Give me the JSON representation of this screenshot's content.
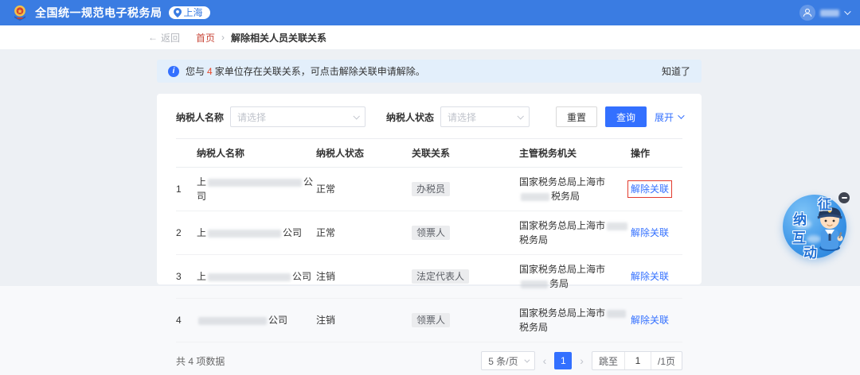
{
  "header": {
    "title": "全国统一规范电子税务局",
    "location": "上海"
  },
  "breadcrumb": {
    "back": "返回",
    "home": "首页",
    "sep": "›",
    "current": "解除相关人员关联关系"
  },
  "banner": {
    "before": "您与",
    "count": "4",
    "after": "家单位存在关联关系，可点击解除关联申请解除。",
    "dismiss": "知道了"
  },
  "filters": {
    "name_label": "纳税人名称",
    "name_value": "请选择",
    "status_label": "纳税人状态",
    "status_value": "请选择",
    "reset": "重置",
    "search": "查询",
    "expand": "展开"
  },
  "table": {
    "headers": [
      "纳税人名称",
      "纳税人状态",
      "关联关系",
      "主管税务机关",
      "操作"
    ],
    "rows": [
      {
        "index": "1",
        "name_prefix": "上",
        "name_suffix": "公司",
        "status": "正常",
        "relation": "办税员",
        "office_prefix": "国家税务总局上海市",
        "office_suffix": "税务局",
        "action": "解除关联"
      },
      {
        "index": "2",
        "name_prefix": "上",
        "name_suffix": "公司",
        "status": "正常",
        "relation": "领票人",
        "office_prefix": "国家税务总局上海市",
        "office_suffix": "税务局",
        "action": "解除关联"
      },
      {
        "index": "3",
        "name_prefix": "上",
        "name_suffix": "公司",
        "status": "注销",
        "relation": "法定代表人",
        "office_prefix": "国家税务总局上海市",
        "office_suffix": "务局",
        "action": "解除关联"
      },
      {
        "index": "4",
        "name_prefix": "",
        "name_suffix": "公司",
        "status": "注销",
        "relation": "领票人",
        "office_prefix": "国家税务总局上海市",
        "office_suffix": "税务局",
        "action": "解除关联"
      }
    ],
    "footer_total": "共 4 项数据"
  },
  "pagination": {
    "page_size": "5 条/页",
    "page": "1",
    "prev": "‹",
    "next": "›",
    "jump_label": "跳至",
    "jump_value": "1",
    "jump_suffix": "/1页"
  },
  "widget": {
    "char_1": "征",
    "char_2": "纳",
    "char_3": "互",
    "char_4": "动"
  },
  "icons": {
    "info_glyph": "i",
    "back_arrow": "←"
  },
  "colors": {
    "header_blue": "#3A7CE2",
    "primary_blue": "#3370FF",
    "banner_bg": "#E3EFFB",
    "alert_red": "#E6492D",
    "highlight_red": "#E23B2E",
    "home_crumb_red": "#C9493B"
  }
}
